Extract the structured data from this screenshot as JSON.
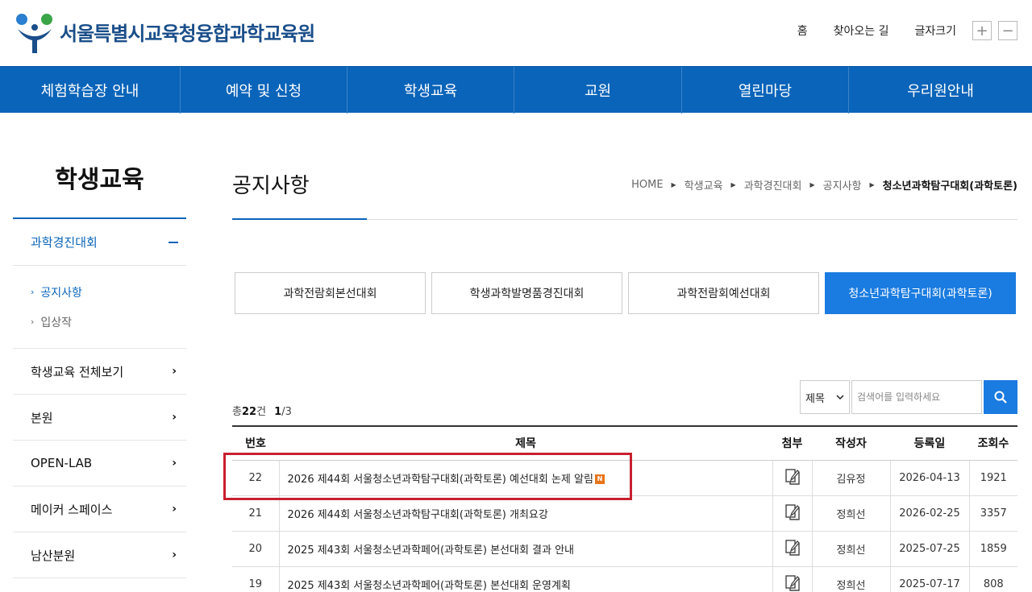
{
  "header": {
    "site_title": "서울특별시교육청융합과학교육원",
    "util": {
      "home": "홈",
      "directions": "찾아오는 길",
      "font_size_label": "글자크기",
      "font_up": "+",
      "font_down": "−"
    }
  },
  "gnb": [
    {
      "label": "체험학습장 안내"
    },
    {
      "label": "예약 및 신청"
    },
    {
      "label": "학생교육"
    },
    {
      "label": "교원"
    },
    {
      "label": "열린마당"
    },
    {
      "label": "우리원안내"
    }
  ],
  "sidebar": {
    "title": "학생교육",
    "active_group": "과학경진대회",
    "sub_items": [
      {
        "label": "공지사항",
        "active": true
      },
      {
        "label": "입상작",
        "active": false
      }
    ],
    "items": [
      {
        "label": "학생교육 전체보기"
      },
      {
        "label": "본원"
      },
      {
        "label": "OPEN-LAB"
      },
      {
        "label": "메이커 스페이스"
      },
      {
        "label": "남산분원"
      }
    ]
  },
  "page": {
    "title": "공지사항",
    "breadcrumb": [
      "HOME",
      "학생교육",
      "과학경진대회",
      "공지사항",
      "청소년과학탐구대회(과학토론)"
    ]
  },
  "tabs": [
    {
      "label": "과학전람회본선대회",
      "active": false
    },
    {
      "label": "학생과학발명품경진대회",
      "active": false
    },
    {
      "label": "과학전람회예선대회",
      "active": false
    },
    {
      "label": "청소년과학탐구대회(과학토론)",
      "active": true
    }
  ],
  "listing": {
    "total_prefix": "총",
    "total": "22",
    "total_suffix": "건",
    "page_current": "1",
    "page_total": "/3"
  },
  "search": {
    "select_value": "제목",
    "placeholder": "검색어를 입력하세요"
  },
  "table": {
    "headers": [
      "번호",
      "제목",
      "첨부",
      "작성자",
      "등록일",
      "조회수"
    ],
    "rows": [
      {
        "no": "22",
        "title": "2026 제44회 서울청소년과학탐구대회(과학토론) 예선대회 논제 알림",
        "is_new": true,
        "new_label": "N",
        "author": "김유정",
        "date": "2026-04-13",
        "views": "1921"
      },
      {
        "no": "21",
        "title": "2026 제44회 서울청소년과학탐구대회(과학토론) 개최요강",
        "is_new": false,
        "author": "정희선",
        "date": "2026-02-25",
        "views": "3357"
      },
      {
        "no": "20",
        "title": "2025 제43회 서울청소년과학페어(과학토론) 본선대회 결과 안내",
        "is_new": false,
        "author": "정희선",
        "date": "2025-07-25",
        "views": "1859"
      },
      {
        "no": "19",
        "title": "2025 제43회 서울청소년과학페어(과학토론) 본선대회 운영계획",
        "is_new": false,
        "author": "정희선",
        "date": "2025-07-17",
        "views": "808"
      }
    ]
  },
  "colors": {
    "primary": "#0a64b9",
    "tab_active": "#1a7be0",
    "highlight": "#c8202f",
    "new_badge": "#e8751a"
  }
}
